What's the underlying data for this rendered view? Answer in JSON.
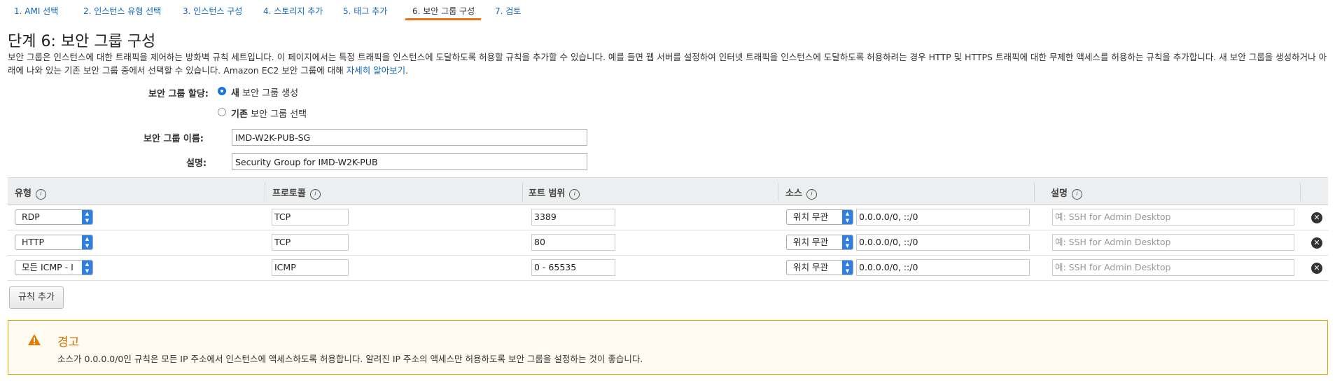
{
  "steps": [
    {
      "label": "1. AMI 선택",
      "active": false
    },
    {
      "label": "2. 인스턴스 유형 선택",
      "active": false
    },
    {
      "label": "3. 인스턴스 구성",
      "active": false
    },
    {
      "label": "4. 스토리지 추가",
      "active": false
    },
    {
      "label": "5. 태그 추가",
      "active": false
    },
    {
      "label": "6. 보안 그룹 구성",
      "active": true
    },
    {
      "label": "7. 검토",
      "active": false
    }
  ],
  "page": {
    "title": "단계 6: 보안 그룹 구성",
    "description": "보안 그룹은 인스턴스에 대한 트래픽을 제어하는 방화벽 규칙 세트입니다. 이 페이지에서는 특정 트래픽을 인스턴스에 도달하도록 허용할 규칙을 추가할 수 있습니다. 예를 들면 웹 서버를 설정하여 인터넷 트래픽을 인스턴스에 도달하도록 허용하려는 경우 HTTP 및 HTTPS 트래픽에 대한 무제한 액세스를 허용하는 규칙을 추가합니다. 새 보안 그룹을 생성하거나 아래에 나와 있는 기존 보안 그룹 중에서 선택할 수 있습니다. Amazon EC2 보안 그룹에 대해",
    "learn_more": "자세히 알아보기",
    "period": "."
  },
  "form": {
    "assign_label": "보안 그룹 할당:",
    "option_new_bold": "새",
    "option_new_rest": " 보안 그룹 생성",
    "option_existing_bold": "기존",
    "option_existing_rest": " 보안 그룹 선택",
    "selected_option": "new",
    "name_label": "보안 그룹 이름:",
    "name_value": "IMD-W2K-PUB-SG",
    "desc_label": "설명:",
    "desc_value": "Security Group for IMD-W2K-PUB"
  },
  "table": {
    "headers": [
      "유형",
      "프로토콜",
      "포트 범위",
      "소스",
      "설명"
    ],
    "info_glyph": "i",
    "rows": [
      {
        "type": "RDP",
        "protocol": "TCP",
        "port": "3389",
        "source_type": "위치 무관",
        "source": "0.0.0.0/0, ::/0",
        "description_placeholder": "예: SSH for Admin Desktop"
      },
      {
        "type": "HTTP",
        "protocol": "TCP",
        "port": "80",
        "source_type": "위치 무관",
        "source": "0.0.0.0/0, ::/0",
        "description_placeholder": "예: SSH for Admin Desktop"
      },
      {
        "type": "모든 ICMP - I",
        "protocol": "ICMP",
        "port": "0 - 65535",
        "source_type": "위치 무관",
        "source": "0.0.0.0/0, ::/0",
        "description_placeholder": "예: SSH for Admin Desktop"
      }
    ],
    "add_rule_label": "규칙 추가"
  },
  "warning": {
    "title": "경고",
    "text": "소스가 0.0.0.0/0인 규칙은 모든 IP 주소에서 인스턴스에 액세스하도록 허용합니다. 알려진 IP 주소의 액세스만 허용하도록 보안 그룹을 설정하는 것이 좋습니다."
  },
  "colors": {
    "link": "#1166bb",
    "active_tab_underline": "#ec7211",
    "warning_border": "#e0a800",
    "warning_title": "#d06d00",
    "radio_selected": "#1a73e8",
    "select_arrow": "#2f7fe0"
  },
  "icons": {
    "info": "info-icon",
    "remove": "remove-icon",
    "warning": "warning-triangle-icon",
    "select_arrow": "select-arrows-icon"
  }
}
